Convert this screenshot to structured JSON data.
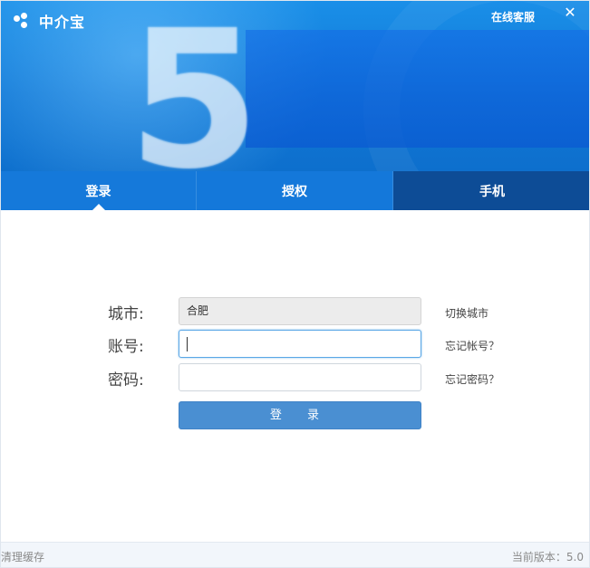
{
  "header": {
    "app_name": "中介宝",
    "support_link": "在线客服",
    "close_symbol": "✕",
    "banner_numeral": "5"
  },
  "tabs": [
    {
      "label": "登录",
      "active": true
    },
    {
      "label": "授权",
      "active": false
    },
    {
      "label": "手机",
      "active": false
    }
  ],
  "form": {
    "city_label": "城市:",
    "city_value": "合肥",
    "account_label": "账号:",
    "account_value": "",
    "password_label": "密码:",
    "password_value": "",
    "switch_city": "切换城市",
    "forgot_account": "忘记帐号？",
    "forgot_password": "忘记密码？",
    "login_button": "登 录"
  },
  "footer": {
    "clear_cache": "清理缓存",
    "version": "当前版本：5.0"
  },
  "colors": {
    "banner_blue": "#1178d6",
    "tab_dark": "#0d4c96",
    "button_blue": "#4a8fd2"
  }
}
